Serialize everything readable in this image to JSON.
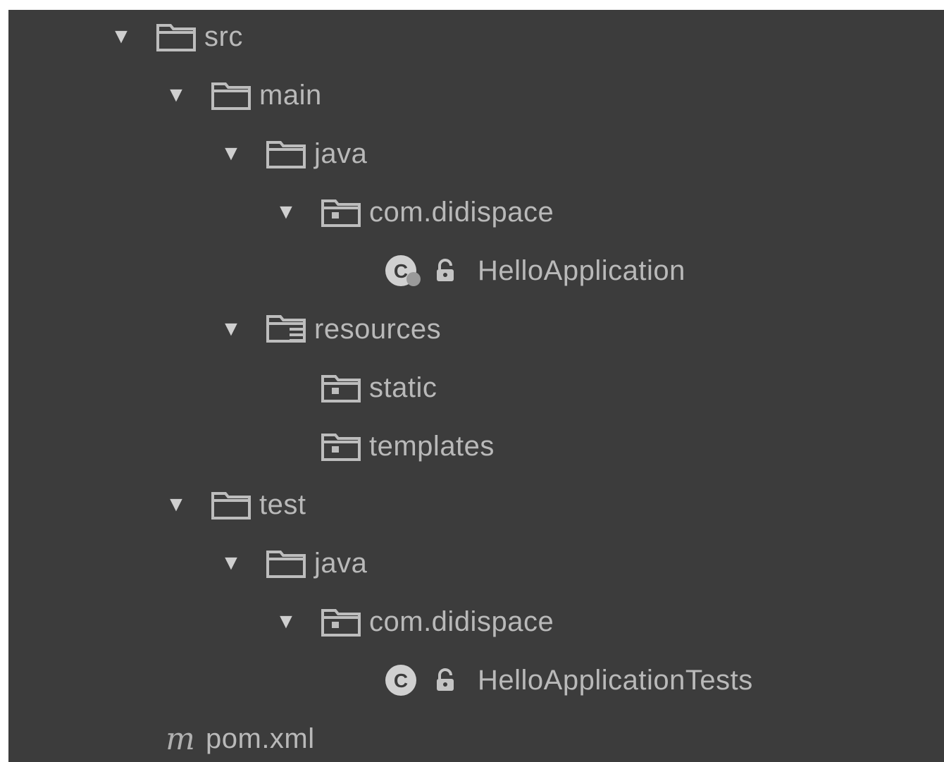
{
  "project_tree": {
    "nodes": [
      {
        "label": "src",
        "icon": "folder-icon",
        "expanded": true
      },
      {
        "label": "main",
        "icon": "folder-icon",
        "expanded": true
      },
      {
        "label": "java",
        "icon": "source-folder-icon",
        "expanded": true
      },
      {
        "label": "com.didispace",
        "icon": "package-icon",
        "expanded": true
      },
      {
        "label": "HelloApplication",
        "icon": "spring-boot-class-icon"
      },
      {
        "label": "resources",
        "icon": "resources-folder-icon",
        "expanded": true
      },
      {
        "label": "static",
        "icon": "package-icon"
      },
      {
        "label": "templates",
        "icon": "package-icon"
      },
      {
        "label": "test",
        "icon": "folder-icon",
        "expanded": true
      },
      {
        "label": "java",
        "icon": "test-source-folder-icon",
        "expanded": true
      },
      {
        "label": "com.didispace",
        "icon": "package-icon",
        "expanded": true
      },
      {
        "label": "HelloApplicationTests",
        "icon": "class-icon"
      },
      {
        "label": "pom.xml",
        "icon": "maven-icon",
        "glyph": "m"
      }
    ]
  },
  "colors": {
    "background": "#3c3c3c",
    "text": "#b9b9b9"
  }
}
